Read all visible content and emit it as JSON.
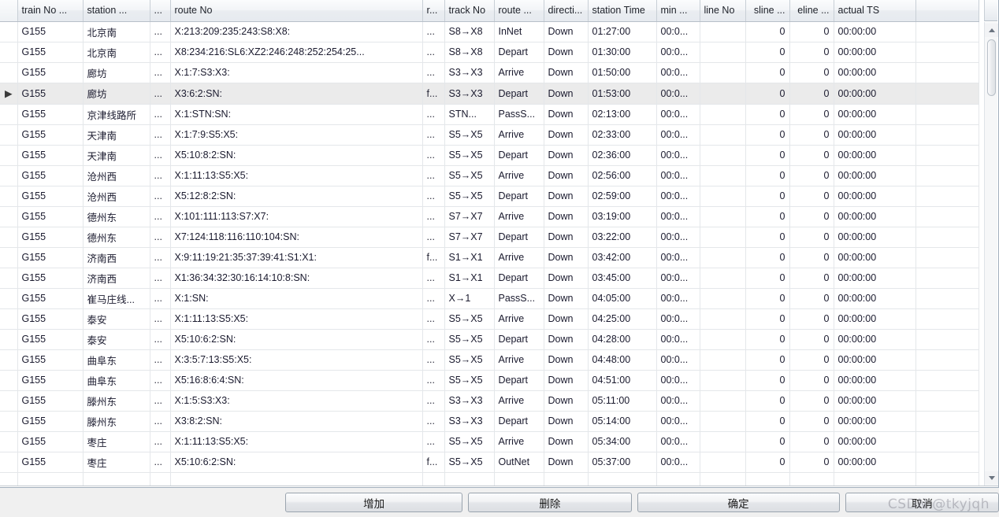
{
  "grid": {
    "columns": [
      {
        "key": "indicator",
        "label": "",
        "align": "center",
        "cls": "c-ind"
      },
      {
        "key": "train_no",
        "label": "train No ...",
        "align": "left",
        "cls": "c-train"
      },
      {
        "key": "station",
        "label": "station ...",
        "align": "left",
        "cls": "c-station"
      },
      {
        "key": "dots1",
        "label": "...",
        "align": "left",
        "cls": "c-dots1"
      },
      {
        "key": "route_no",
        "label": "route No",
        "align": "left",
        "cls": "c-route"
      },
      {
        "key": "dots2",
        "label": "r...",
        "align": "left",
        "cls": "c-dots2"
      },
      {
        "key": "track_no",
        "label": "track No",
        "align": "left",
        "cls": "c-track"
      },
      {
        "key": "route_t",
        "label": "route ...",
        "align": "left",
        "cls": "c-rtype"
      },
      {
        "key": "direction",
        "label": "directi...",
        "align": "left",
        "cls": "c-dir"
      },
      {
        "key": "st_time",
        "label": "station Time",
        "align": "left",
        "cls": "c-sttime"
      },
      {
        "key": "min",
        "label": "min ...",
        "align": "left",
        "cls": "c-min"
      },
      {
        "key": "line_no",
        "label": "line No",
        "align": "left",
        "cls": "c-lineno"
      },
      {
        "key": "sline",
        "label": "sline ...",
        "align": "right",
        "cls": "c-sline"
      },
      {
        "key": "eline",
        "label": "eline ...",
        "align": "right",
        "cls": "c-eline"
      },
      {
        "key": "actual_ts",
        "label": "actual TS",
        "align": "left",
        "cls": "c-actual"
      },
      {
        "key": "tail",
        "label": "",
        "align": "left",
        "cls": "c-tail"
      }
    ],
    "selected_row_index": 3,
    "rows": [
      {
        "indicator": "",
        "train_no": "G155",
        "station": "北京南",
        "dots1": "...",
        "route_no": "X:213:209:235:243:S8:X8:",
        "dots2": "...",
        "track_no": "S8→X8",
        "route_t": "InNet",
        "direction": "Down",
        "st_time": "01:27:00",
        "min": "00:0...",
        "line_no": "",
        "sline": "0",
        "eline": "0",
        "actual_ts": "00:00:00",
        "tail": ""
      },
      {
        "indicator": "",
        "train_no": "G155",
        "station": "北京南",
        "dots1": "...",
        "route_no": "X8:234:216:SL6:XZ2:246:248:252:254:25...",
        "dots2": "...",
        "track_no": "S8→X8",
        "route_t": "Depart",
        "direction": "Down",
        "st_time": "01:30:00",
        "min": "00:0...",
        "line_no": "",
        "sline": "0",
        "eline": "0",
        "actual_ts": "00:00:00",
        "tail": ""
      },
      {
        "indicator": "",
        "train_no": "G155",
        "station": "廊坊",
        "dots1": "...",
        "route_no": "X:1:7:S3:X3:",
        "dots2": "...",
        "track_no": "S3→X3",
        "route_t": "Arrive",
        "direction": "Down",
        "st_time": "01:50:00",
        "min": "00:0...",
        "line_no": "",
        "sline": "0",
        "eline": "0",
        "actual_ts": "00:00:00",
        "tail": ""
      },
      {
        "indicator": "▶",
        "train_no": "G155",
        "station": "廊坊",
        "dots1": "...",
        "route_no": "X3:6:2:SN:",
        "dots2": "f...",
        "track_no": "S3→X3",
        "route_t": "Depart",
        "direction": "Down",
        "st_time": "01:53:00",
        "min": "00:0...",
        "line_no": "",
        "sline": "0",
        "eline": "0",
        "actual_ts": "00:00:00",
        "tail": ""
      },
      {
        "indicator": "",
        "train_no": "G155",
        "station": "京津线路所",
        "dots1": "...",
        "route_no": "X:1:STN:SN:",
        "dots2": "...",
        "track_no": "STN...",
        "route_t": "PassS...",
        "direction": "Down",
        "st_time": "02:13:00",
        "min": "00:0...",
        "line_no": "",
        "sline": "0",
        "eline": "0",
        "actual_ts": "00:00:00",
        "tail": ""
      },
      {
        "indicator": "",
        "train_no": "G155",
        "station": "天津南",
        "dots1": "...",
        "route_no": "X:1:7:9:S5:X5:",
        "dots2": "...",
        "track_no": "S5→X5",
        "route_t": "Arrive",
        "direction": "Down",
        "st_time": "02:33:00",
        "min": "00:0...",
        "line_no": "",
        "sline": "0",
        "eline": "0",
        "actual_ts": "00:00:00",
        "tail": ""
      },
      {
        "indicator": "",
        "train_no": "G155",
        "station": "天津南",
        "dots1": "...",
        "route_no": "X5:10:8:2:SN:",
        "dots2": "...",
        "track_no": "S5→X5",
        "route_t": "Depart",
        "direction": "Down",
        "st_time": "02:36:00",
        "min": "00:0...",
        "line_no": "",
        "sline": "0",
        "eline": "0",
        "actual_ts": "00:00:00",
        "tail": ""
      },
      {
        "indicator": "",
        "train_no": "G155",
        "station": "沧州西",
        "dots1": "...",
        "route_no": "X:1:11:13:S5:X5:",
        "dots2": "...",
        "track_no": "S5→X5",
        "route_t": "Arrive",
        "direction": "Down",
        "st_time": "02:56:00",
        "min": "00:0...",
        "line_no": "",
        "sline": "0",
        "eline": "0",
        "actual_ts": "00:00:00",
        "tail": ""
      },
      {
        "indicator": "",
        "train_no": "G155",
        "station": "沧州西",
        "dots1": "...",
        "route_no": "X5:12:8:2:SN:",
        "dots2": "...",
        "track_no": "S5→X5",
        "route_t": "Depart",
        "direction": "Down",
        "st_time": "02:59:00",
        "min": "00:0...",
        "line_no": "",
        "sline": "0",
        "eline": "0",
        "actual_ts": "00:00:00",
        "tail": ""
      },
      {
        "indicator": "",
        "train_no": "G155",
        "station": "德州东",
        "dots1": "...",
        "route_no": "X:101:111:113:S7:X7:",
        "dots2": "...",
        "track_no": "S7→X7",
        "route_t": "Arrive",
        "direction": "Down",
        "st_time": "03:19:00",
        "min": "00:0...",
        "line_no": "",
        "sline": "0",
        "eline": "0",
        "actual_ts": "00:00:00",
        "tail": ""
      },
      {
        "indicator": "",
        "train_no": "G155",
        "station": "德州东",
        "dots1": "...",
        "route_no": "X7:124:118:116:110:104:SN:",
        "dots2": "...",
        "track_no": "S7→X7",
        "route_t": "Depart",
        "direction": "Down",
        "st_time": "03:22:00",
        "min": "00:0...",
        "line_no": "",
        "sline": "0",
        "eline": "0",
        "actual_ts": "00:00:00",
        "tail": ""
      },
      {
        "indicator": "",
        "train_no": "G155",
        "station": "济南西",
        "dots1": "...",
        "route_no": "X:9:11:19:21:35:37:39:41:S1:X1:",
        "dots2": "f...",
        "track_no": "S1→X1",
        "route_t": "Arrive",
        "direction": "Down",
        "st_time": "03:42:00",
        "min": "00:0...",
        "line_no": "",
        "sline": "0",
        "eline": "0",
        "actual_ts": "00:00:00",
        "tail": ""
      },
      {
        "indicator": "",
        "train_no": "G155",
        "station": "济南西",
        "dots1": "...",
        "route_no": "X1:36:34:32:30:16:14:10:8:SN:",
        "dots2": "...",
        "track_no": "S1→X1",
        "route_t": "Depart",
        "direction": "Down",
        "st_time": "03:45:00",
        "min": "00:0...",
        "line_no": "",
        "sline": "0",
        "eline": "0",
        "actual_ts": "00:00:00",
        "tail": ""
      },
      {
        "indicator": "",
        "train_no": "G155",
        "station": "崔马庄线...",
        "dots1": "...",
        "route_no": "X:1:SN:",
        "dots2": "...",
        "track_no": "X→1",
        "route_t": "PassS...",
        "direction": "Down",
        "st_time": "04:05:00",
        "min": "00:0...",
        "line_no": "",
        "sline": "0",
        "eline": "0",
        "actual_ts": "00:00:00",
        "tail": ""
      },
      {
        "indicator": "",
        "train_no": "G155",
        "station": "泰安",
        "dots1": "...",
        "route_no": "X:1:11:13:S5:X5:",
        "dots2": "...",
        "track_no": "S5→X5",
        "route_t": "Arrive",
        "direction": "Down",
        "st_time": "04:25:00",
        "min": "00:0...",
        "line_no": "",
        "sline": "0",
        "eline": "0",
        "actual_ts": "00:00:00",
        "tail": ""
      },
      {
        "indicator": "",
        "train_no": "G155",
        "station": "泰安",
        "dots1": "...",
        "route_no": "X5:10:6:2:SN:",
        "dots2": "...",
        "track_no": "S5→X5",
        "route_t": "Depart",
        "direction": "Down",
        "st_time": "04:28:00",
        "min": "00:0...",
        "line_no": "",
        "sline": "0",
        "eline": "0",
        "actual_ts": "00:00:00",
        "tail": ""
      },
      {
        "indicator": "",
        "train_no": "G155",
        "station": "曲阜东",
        "dots1": "...",
        "route_no": "X:3:5:7:13:S5:X5:",
        "dots2": "...",
        "track_no": "S5→X5",
        "route_t": "Arrive",
        "direction": "Down",
        "st_time": "04:48:00",
        "min": "00:0...",
        "line_no": "",
        "sline": "0",
        "eline": "0",
        "actual_ts": "00:00:00",
        "tail": ""
      },
      {
        "indicator": "",
        "train_no": "G155",
        "station": "曲阜东",
        "dots1": "...",
        "route_no": "X5:16:8:6:4:SN:",
        "dots2": "...",
        "track_no": "S5→X5",
        "route_t": "Depart",
        "direction": "Down",
        "st_time": "04:51:00",
        "min": "00:0...",
        "line_no": "",
        "sline": "0",
        "eline": "0",
        "actual_ts": "00:00:00",
        "tail": ""
      },
      {
        "indicator": "",
        "train_no": "G155",
        "station": "滕州东",
        "dots1": "...",
        "route_no": "X:1:5:S3:X3:",
        "dots2": "...",
        "track_no": "S3→X3",
        "route_t": "Arrive",
        "direction": "Down",
        "st_time": "05:11:00",
        "min": "00:0...",
        "line_no": "",
        "sline": "0",
        "eline": "0",
        "actual_ts": "00:00:00",
        "tail": ""
      },
      {
        "indicator": "",
        "train_no": "G155",
        "station": "滕州东",
        "dots1": "...",
        "route_no": "X3:8:2:SN:",
        "dots2": "...",
        "track_no": "S3→X3",
        "route_t": "Depart",
        "direction": "Down",
        "st_time": "05:14:00",
        "min": "00:0...",
        "line_no": "",
        "sline": "0",
        "eline": "0",
        "actual_ts": "00:00:00",
        "tail": ""
      },
      {
        "indicator": "",
        "train_no": "G155",
        "station": "枣庄",
        "dots1": "...",
        "route_no": "X:1:11:13:S5:X5:",
        "dots2": "...",
        "track_no": "S5→X5",
        "route_t": "Arrive",
        "direction": "Down",
        "st_time": "05:34:00",
        "min": "00:0...",
        "line_no": "",
        "sline": "0",
        "eline": "0",
        "actual_ts": "00:00:00",
        "tail": ""
      },
      {
        "indicator": "",
        "train_no": "G155",
        "station": "枣庄",
        "dots1": "...",
        "route_no": "X5:10:6:2:SN:",
        "dots2": "f...",
        "track_no": "S5→X5",
        "route_t": "OutNet",
        "direction": "Down",
        "st_time": "05:37:00",
        "min": "00:0...",
        "line_no": "",
        "sline": "0",
        "eline": "0",
        "actual_ts": "00:00:00",
        "tail": ""
      },
      {
        "indicator": "",
        "train_no": "",
        "station": "",
        "dots1": "",
        "route_no": "",
        "dots2": "",
        "track_no": "",
        "route_t": "",
        "direction": "",
        "st_time": "",
        "min": "",
        "line_no": "",
        "sline": "",
        "eline": "",
        "actual_ts": "",
        "tail": ""
      }
    ]
  },
  "buttons": {
    "add": "增加",
    "delete": "删除",
    "confirm": "确定",
    "cancel": "取消"
  },
  "watermark": "CSDN @tkyjqh",
  "scrollbar": {
    "up_arrow": "scroll-up-arrow",
    "down_arrow": "scroll-down-arrow"
  }
}
